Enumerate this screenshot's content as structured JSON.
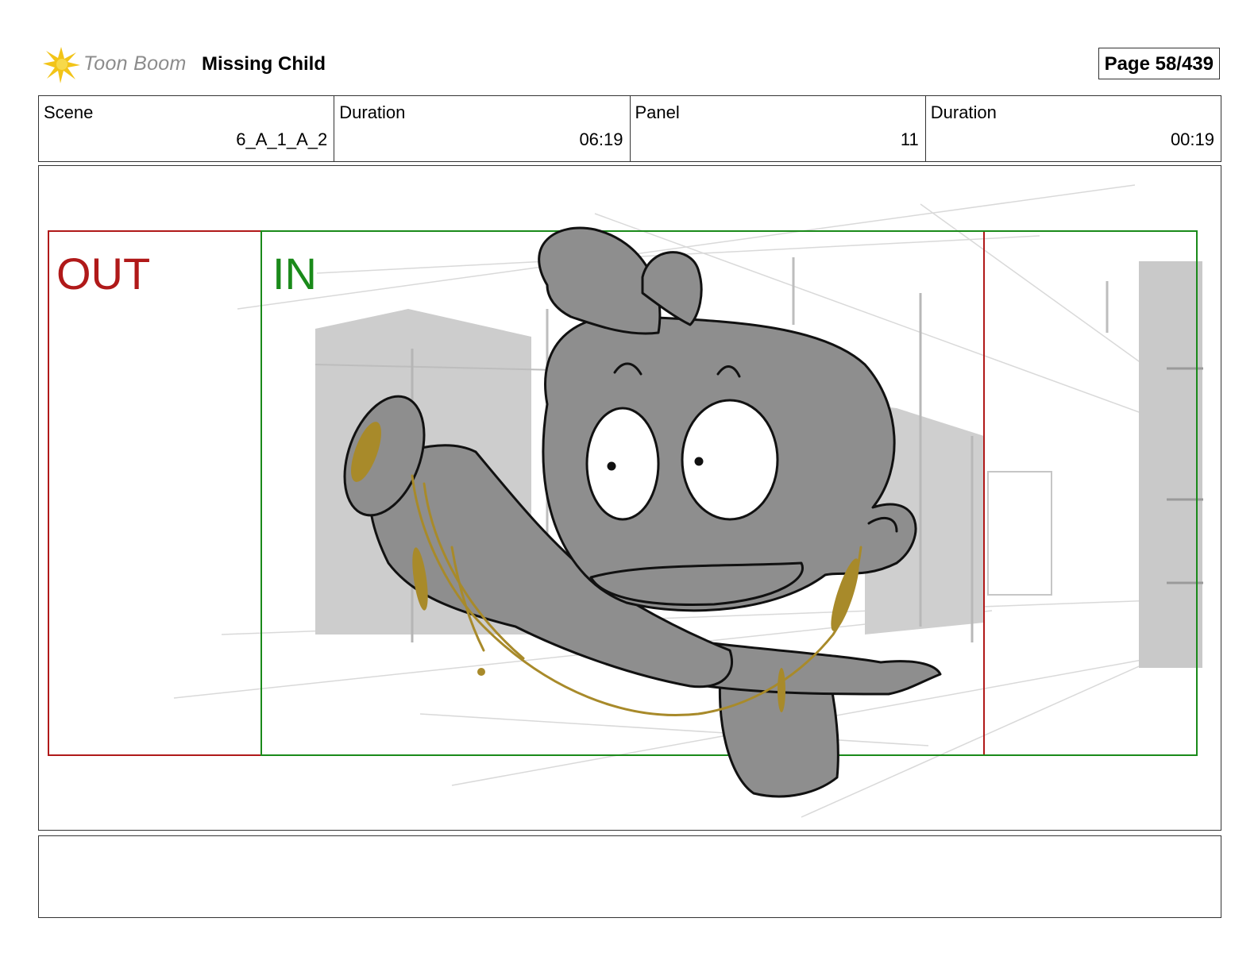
{
  "header": {
    "brand": "Toon Boom",
    "title": "Missing Child",
    "page": "Page  58/439",
    "logo_icon": "starburst-logo-icon"
  },
  "meta": [
    {
      "label": "Scene",
      "value": "6_A_1_A_2"
    },
    {
      "label": "Duration",
      "value": "06:19"
    },
    {
      "label": "Panel",
      "value": "11"
    },
    {
      "label": "Duration",
      "value": "00:19"
    }
  ],
  "panel": {
    "out_label": "OUT",
    "in_label": "IN"
  },
  "notes": {
    "text": ""
  },
  "colors": {
    "out_frame": "#b01919",
    "in_frame": "#1a8a1a",
    "character_fill": "#8e8e8e",
    "prop_gold": "#a88a2a",
    "building_fill": "#cfcfcf"
  }
}
